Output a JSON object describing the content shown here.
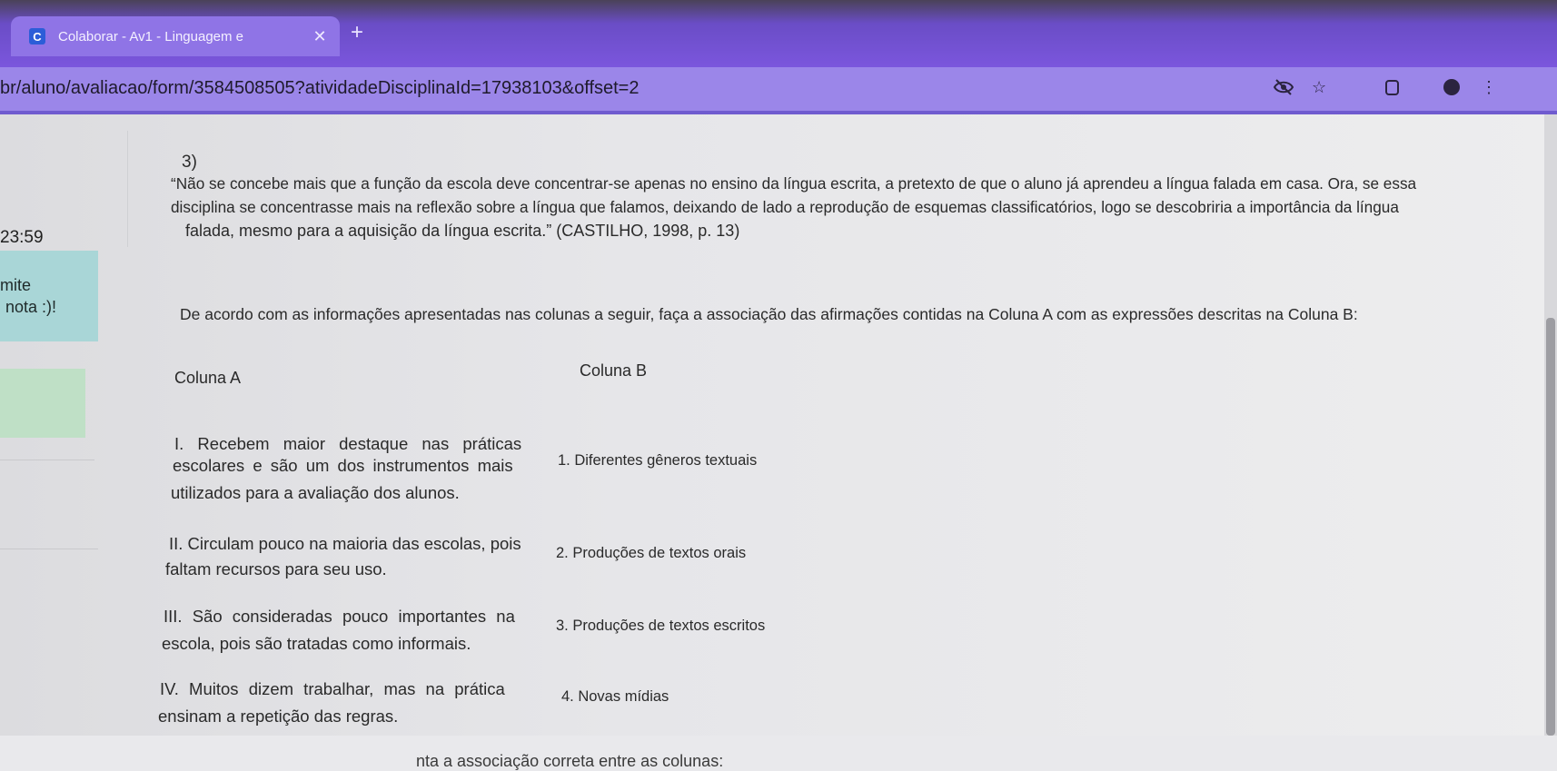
{
  "browser": {
    "tab_title": "Colaborar - Av1 - Linguagem e",
    "tab_close": "✕",
    "new_tab": "+",
    "favicon_letter": "C",
    "url": "br/aluno/avaliacao/form/3584508505?atividadeDisciplinaId=17938103&offset=2",
    "icons": [
      "eye-slash-icon",
      "star-icon",
      "extension-icon",
      "profile-icon",
      "menu-icon"
    ]
  },
  "sidebar": {
    "timer": "23:59",
    "box_line1": "mite",
    "box_line2": "nota :)!"
  },
  "question": {
    "number": "3)",
    "quote_line1": "“Não se concebe mais que a função da escola deve concentrar-se apenas no ensino da língua escrita, a pretexto de que o aluno já aprendeu a língua falada em casa. Ora, se essa",
    "quote_line2": "disciplina se concentrasse mais na reflexão sobre a língua que falamos, deixando de lado a reprodução de esquemas classificatórios, logo se descobriria a importância da língua",
    "quote_line3": "falada, mesmo para a aquisição da língua escrita.” (CASTILHO, 1998, p. 13)",
    "instruction": "De acordo com as informações apresentadas nas colunas a seguir, faça a associação das afirmações contidas na Coluna A com as expressões descritas na Coluna B:",
    "column_a_header": "Coluna A",
    "column_b_header": "Coluna B",
    "a1_line1": "I. Recebem maior destaque nas práticas",
    "a1_line2": "escolares e são um dos instrumentos mais",
    "a1_line3": "utilizados para a avaliação dos alunos.",
    "b1": "1. Diferentes gêneros textuais",
    "a2_line1": "II. Circulam pouco na maioria das escolas, pois",
    "a2_line2": "faltam recursos para seu uso.",
    "b2": "2. Produções de textos orais",
    "a3_line1": "III. São consideradas pouco importantes na",
    "a3_line2": "escola, pois são tratadas como informais.",
    "b3": "3. Produções de textos escritos",
    "a4_line1": "IV. Muitos dizem trabalhar, mas na prática",
    "a4_line2": "ensinam a repetição das regras.",
    "b4": "4. Novas mídias",
    "prompt": "nta a associação correta entre as colunas:"
  }
}
